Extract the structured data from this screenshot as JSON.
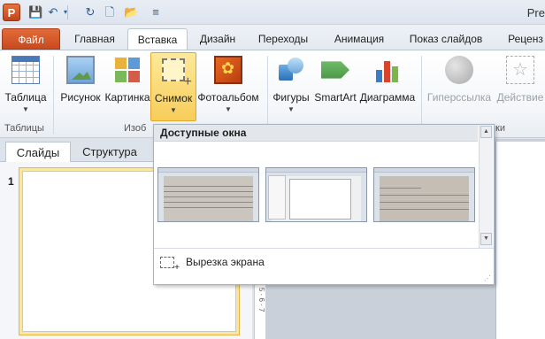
{
  "app": {
    "icon_letter": "P",
    "title_fragment": "Pre"
  },
  "qat": {
    "items": [
      "save-icon",
      "undo-icon",
      "redo-icon",
      "new-icon",
      "open-icon",
      "customize-icon"
    ]
  },
  "tabs": [
    "Файл",
    "Главная",
    "Вставка",
    "Дизайн",
    "Переходы",
    "Анимация",
    "Показ слайдов",
    "Реценз"
  ],
  "active_tab": "Вставка",
  "ribbon": {
    "table": {
      "label": "Таблица",
      "group": "Таблицы"
    },
    "picture": {
      "label": "Рисунок"
    },
    "clip": {
      "label": "Картинка"
    },
    "snapshot": {
      "label": "Снимок"
    },
    "album": {
      "label": "Фотоальбом"
    },
    "images_group": "Изоб",
    "shapes": {
      "label": "Фигуры"
    },
    "smartart": {
      "label": "SmartArt"
    },
    "chart": {
      "label": "Диаграмма"
    },
    "hyperlink": {
      "label": "Гиперссылка"
    },
    "action": {
      "label": "Действие"
    },
    "links_group_fragment": "ки"
  },
  "left_pane": {
    "tabs": [
      "Слайды",
      "Структура"
    ],
    "close": "×",
    "slide_number": "1"
  },
  "ruler": {
    "marks": "· 5 · 6 · 7"
  },
  "dropdown": {
    "header": "Доступные окна",
    "windows": [
      {
        "name": "window-thumbnail-document"
      },
      {
        "name": "window-thumbnail-powerpoint"
      },
      {
        "name": "window-thumbnail-document-2"
      }
    ],
    "screen_clipping": "Вырезка экрана"
  },
  "colors": {
    "file_tab": "#d35a2a",
    "snapshot_highlight": "#f8cd5a",
    "ribbon_bg": "#f4f6f9"
  }
}
